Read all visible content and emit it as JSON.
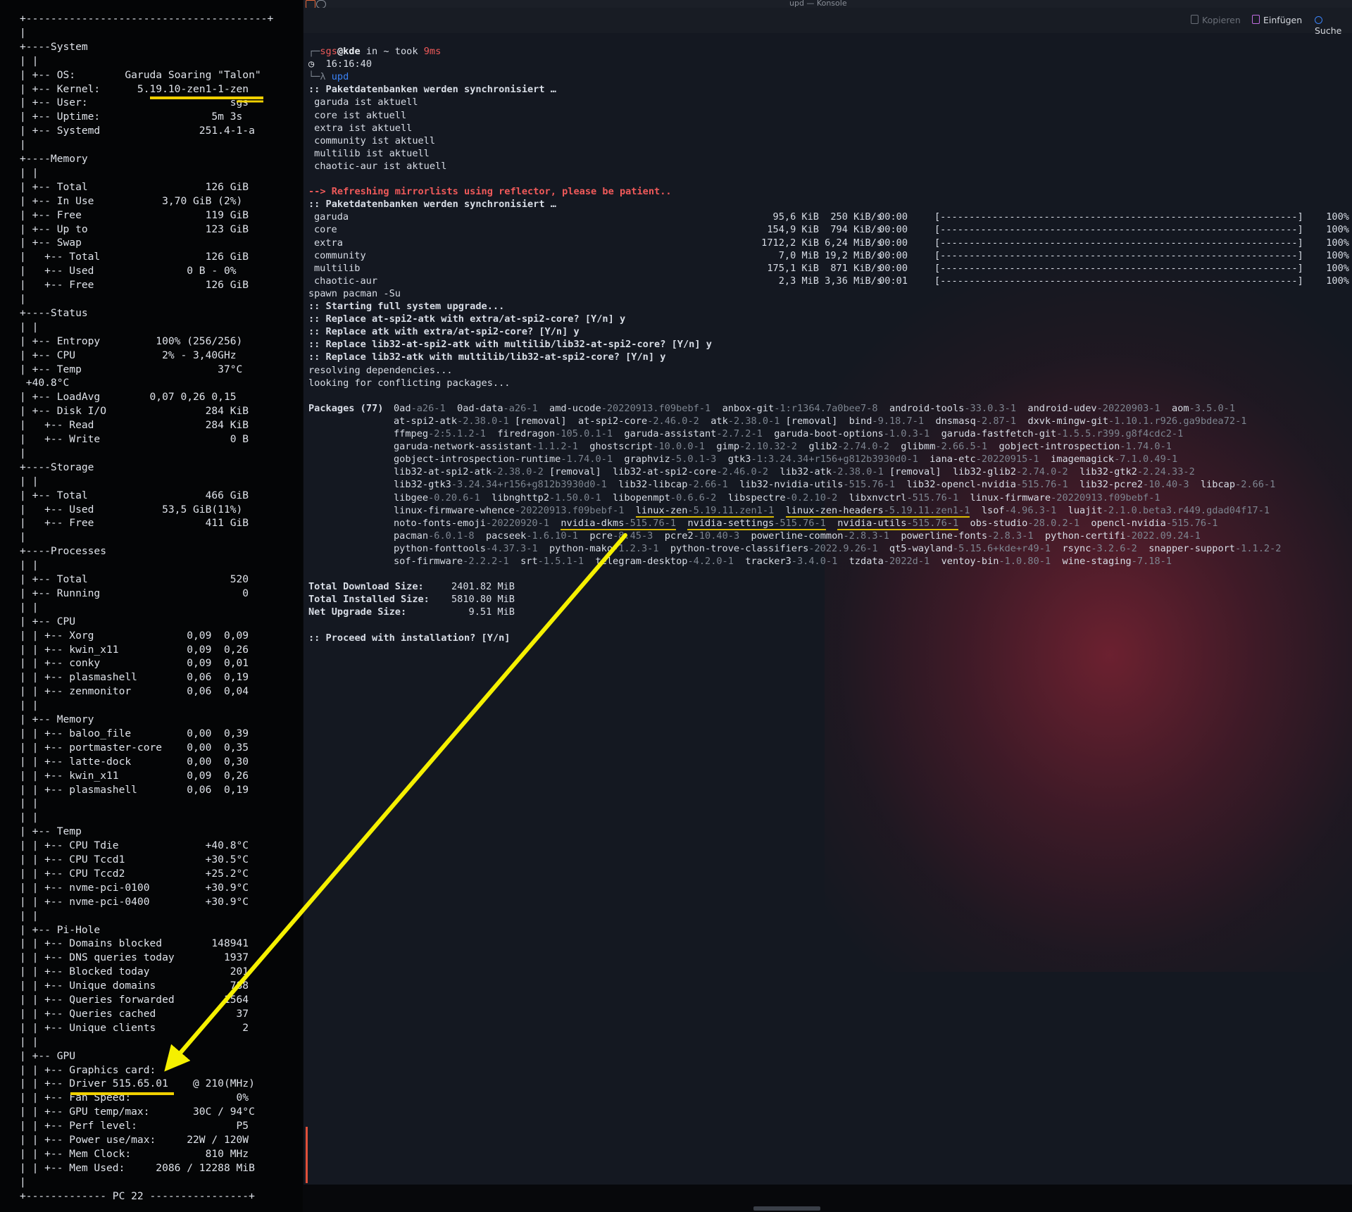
{
  "conky": {
    "lines": [
      "+---------------------------------------+",
      "|",
      "+----System",
      "| |",
      "| +-- OS:        Garuda Soaring \"Talon\"",
      "| +-- Kernel:      5.19.10-zen1-1-zen",
      "| +-- User:                       sgs",
      "| +-- Uptime:                  5m 3s",
      "| +-- Systemd                251.4-1-a",
      "|",
      "+----Memory",
      "| |",
      "| +-- Total                   126 GiB",
      "| +-- In Use           3,70 GiB (2%)",
      "| +-- Free                    119 GiB",
      "| +-- Up to                   123 GiB",
      "| +-- Swap",
      "|   +-- Total                 126 GiB",
      "|   +-- Used               0 B - 0%",
      "|   +-- Free                  126 GiB",
      "|",
      "+----Status",
      "| |",
      "| +-- Entropy         100% (256/256)",
      "| +-- CPU              2% - 3,40GHz",
      "| +-- Temp                      37°C",
      " +40.8°C",
      "| +-- LoadAvg        0,07 0,26 0,15",
      "| +-- Disk I/O                284 KiB",
      "|   +-- Read                  284 KiB",
      "|   +-- Write                     0 B",
      "|",
      "+----Storage",
      "| |",
      "| +-- Total                   466 GiB",
      "|   +-- Used           53,5 GiB(11%)",
      "|   +-- Free                  411 GiB",
      "|",
      "+----Processes",
      "| |",
      "| +-- Total                       520",
      "| +-- Running                       0",
      "| |",
      "| +-- CPU",
      "| | +-- Xorg               0,09  0,09",
      "| | +-- kwin_x11           0,09  0,26",
      "| | +-- conky              0,09  0,01",
      "| | +-- plasmashell        0,06  0,19",
      "| | +-- zenmonitor         0,06  0,04",
      "| |",
      "| +-- Memory",
      "| | +-- baloo_file         0,00  0,39",
      "| | +-- portmaster-core    0,00  0,35",
      "| | +-- latte-dock         0,00  0,30",
      "| | +-- kwin_x11           0,09  0,26",
      "| | +-- plasmashell        0,06  0,19",
      "| |",
      "| |",
      "| +-- Temp",
      "| | +-- CPU Tdie              +40.8°C",
      "| | +-- CPU Tccd1             +30.5°C",
      "| | +-- CPU Tccd2             +25.2°C",
      "| | +-- nvme-pci-0100         +30.9°C",
      "| | +-- nvme-pci-0400         +30.9°C",
      "| |",
      "| +-- Pi-Hole",
      "| | +-- Domains blocked        148941",
      "| | +-- DNS queries today        1937",
      "| | +-- Blocked today             201",
      "| | +-- Unique domains            788",
      "| | +-- Queries forwarded        1564",
      "| | +-- Queries cached             37",
      "| | +-- Unique clients              2",
      "| |",
      "| +-- GPU",
      "| | +-- Graphics card:",
      "| | +-- Driver 515.65.01    @ 210(MHz)",
      "| | +-- Fan Speed:                 0%",
      "| | +-- GPU temp/max:       30C / 94°C",
      "| | +-- Perf level:                P5",
      "| | +-- Power use/max:     22W / 120W",
      "| | +-- Mem Clock:            810 MHz",
      "| | +-- Mem Used:     2086 / 12288 MiB",
      "|",
      "+------------- PC 22 ----------------+"
    ]
  },
  "window": {
    "title": "upd — Konsole",
    "toolbar": {
      "copy": "Kopieren",
      "paste": "Einfügen",
      "search": "Suche"
    }
  },
  "terminal": {
    "prompt": {
      "user": "sgs",
      "host": "kde",
      "in": " in ~ took ",
      "took": "9ms",
      "time": "16:16:40",
      "cmd": "upd"
    },
    "sync_header": ":: Paketdatenbanken werden synchronisiert …",
    "up_to_date": [
      " garuda ist aktuell",
      " core ist aktuell",
      " extra ist aktuell",
      " community ist aktuell",
      " multilib ist aktuell",
      " chaotic-aur ist aktuell"
    ],
    "reflector": "--> Refreshing mirrorlists using reflector, please be patient..",
    "sync_header2": ":: Paketdatenbanken werden synchronisiert …",
    "downloads": [
      {
        "repo": "garuda",
        "size": "95,6 KiB",
        "speed": "250 KiB/s",
        "time": "00:00",
        "pct": "100%"
      },
      {
        "repo": "core",
        "size": "154,9 KiB",
        "speed": "794 KiB/s",
        "time": "00:00",
        "pct": "100%"
      },
      {
        "repo": "extra",
        "size": "1712,2 KiB",
        "speed": "6,24 MiB/s",
        "time": "00:00",
        "pct": "100%"
      },
      {
        "repo": "community",
        "size": "7,0 MiB",
        "speed": "19,2 MiB/s",
        "time": "00:00",
        "pct": "100%"
      },
      {
        "repo": "multilib",
        "size": "175,1 KiB",
        "speed": "871 KiB/s",
        "time": "00:00",
        "pct": "100%"
      },
      {
        "repo": "chaotic-aur",
        "size": "2,3 MiB",
        "speed": "3,36 MiB/s",
        "time": "00:01",
        "pct": "100%"
      }
    ],
    "spawn": "spawn pacman -Su",
    "upgrade": [
      ":: Starting full system upgrade...",
      ":: Replace at-spi2-atk with extra/at-spi2-core? [Y/n] y",
      ":: Replace atk with extra/at-spi2-core? [Y/n] y",
      ":: Replace lib32-at-spi2-atk with multilib/lib32-at-spi2-core? [Y/n] y",
      ":: Replace lib32-atk with multilib/lib32-at-spi2-core? [Y/n] y"
    ],
    "resolving": "resolving dependencies...",
    "conflicts": "looking for conflicting packages...",
    "packages_label": "Packages (77)",
    "package_lines": [
      [
        [
          "0ad",
          "-a26-1"
        ],
        [
          "0ad-data",
          "-a26-1"
        ],
        [
          "amd-ucode",
          "-20220913.f09bebf-1"
        ],
        [
          "anbox-git",
          "-1:r1364.7a0bee7-8"
        ],
        [
          "android-tools",
          "-33.0.3-1"
        ],
        [
          "android-udev",
          "-20220903-1"
        ],
        [
          "aom",
          "-3.5.0-1"
        ]
      ],
      [
        [
          "at-spi2-atk",
          "-2.38.0-1",
          "[removal]"
        ],
        [
          "at-spi2-core",
          "-2.46.0-2"
        ],
        [
          "atk",
          "-2.38.0-1",
          "[removal]"
        ],
        [
          "bind",
          "-9.18.7-1"
        ],
        [
          "dnsmasq",
          "-2.87-1"
        ],
        [
          "dxvk-mingw-git",
          "-1.10.1.r926.ga9bdea72-1"
        ]
      ],
      [
        [
          "ffmpeg",
          "-2:5.1.2-1"
        ],
        [
          "firedragon",
          "-105.0.1-1"
        ],
        [
          "garuda-assistant",
          "-2.7.2-1"
        ],
        [
          "garuda-boot-options",
          "-1.0.3-1"
        ],
        [
          "garuda-fastfetch-git",
          "-1.5.5.r399.g8f4cdc2-1"
        ]
      ],
      [
        [
          "garuda-network-assistant",
          "-1.1.2-1"
        ],
        [
          "ghostscript",
          "-10.0.0-1"
        ],
        [
          "gimp",
          "-2.10.32-2"
        ],
        [
          "glib2",
          "-2.74.0-2"
        ],
        [
          "glibmm",
          "-2.66.5-1"
        ],
        [
          "gobject-introspection",
          "-1.74.0-1"
        ]
      ],
      [
        [
          "gobject-introspection-runtime",
          "-1.74.0-1"
        ],
        [
          "graphviz",
          "-5.0.1-3"
        ],
        [
          "gtk3",
          "-1:3.24.34+r156+g812b3930d0-1"
        ],
        [
          "iana-etc",
          "-20220915-1"
        ],
        [
          "imagemagick",
          "-7.1.0.49-1"
        ]
      ],
      [
        [
          "lib32-at-spi2-atk",
          "-2.38.0-2",
          "[removal]"
        ],
        [
          "lib32-at-spi2-core",
          "-2.46.0-2"
        ],
        [
          "lib32-atk",
          "-2.38.0-1",
          "[removal]"
        ],
        [
          "lib32-glib2",
          "-2.74.0-2"
        ],
        [
          "lib32-gtk2",
          "-2.24.33-2"
        ]
      ],
      [
        [
          "lib32-gtk3",
          "-3.24.34+r156+g812b3930d0-1"
        ],
        [
          "lib32-libcap",
          "-2.66-1"
        ],
        [
          "lib32-nvidia-utils",
          "-515.76-1"
        ],
        [
          "lib32-opencl-nvidia",
          "-515.76-1"
        ],
        [
          "lib32-pcre2",
          "-10.40-3"
        ],
        [
          "libcap",
          "-2.66-1"
        ]
      ],
      [
        [
          "libgee",
          "-0.20.6-1"
        ],
        [
          "libnghttp2",
          "-1.50.0-1"
        ],
        [
          "libopenmpt",
          "-0.6.6-2"
        ],
        [
          "libspectre",
          "-0.2.10-2"
        ],
        [
          "libxnvctrl",
          "-515.76-1"
        ],
        [
          "linux-firmware",
          "-20220913.f09bebf-1"
        ]
      ],
      [
        [
          "linux-firmware-whence",
          "-20220913.f09bebf-1"
        ],
        [
          "linux-zen",
          "-5.19.11.zen1-1",
          "",
          "u"
        ],
        [
          "linux-zen-headers",
          "-5.19.11.zen1-1",
          "",
          "u"
        ],
        [
          "lsof",
          "-4.96.3-1"
        ],
        [
          "luajit",
          "-2.1.0.beta3.r449.gdad04f17-1"
        ]
      ],
      [
        [
          "noto-fonts-emoji",
          "-20220920-1"
        ],
        [
          "nvidia-dkms",
          "-515.76-1",
          "",
          "u"
        ],
        [
          "nvidia-settings",
          "-515.76-1",
          "",
          "u"
        ],
        [
          "nvidia-utils",
          "-515.76-1",
          "",
          "u"
        ],
        [
          "obs-studio",
          "-28.0.2-1"
        ],
        [
          "opencl-nvidia",
          "-515.76-1"
        ]
      ],
      [
        [
          "pacman",
          "-6.0.1-8"
        ],
        [
          "pacseek",
          "-1.6.10-1"
        ],
        [
          "pcre",
          "-8.45-3"
        ],
        [
          "pcre2",
          "-10.40-3"
        ],
        [
          "powerline-common",
          "-2.8.3-1"
        ],
        [
          "powerline-fonts",
          "-2.8.3-1"
        ],
        [
          "python-certifi",
          "-2022.09.24-1"
        ]
      ],
      [
        [
          "python-fonttools",
          "-4.37.3-1"
        ],
        [
          "python-mako",
          "-1.2.3-1"
        ],
        [
          "python-trove-classifiers",
          "-2022.9.26-1"
        ],
        [
          "qt5-wayland",
          "-5.15.6+kde+r49-1"
        ],
        [
          "rsync",
          "-3.2.6-2"
        ],
        [
          "snapper-support",
          "-1.1.2-2"
        ]
      ],
      [
        [
          "sof-firmware",
          "-2.2.2-1"
        ],
        [
          "srt",
          "-1.5.1-1"
        ],
        [
          "telegram-desktop",
          "-4.2.0-1"
        ],
        [
          "tracker3",
          "-3.4.0-1"
        ],
        [
          "tzdata",
          "-2022d-1"
        ],
        [
          "ventoy-bin",
          "-1.0.80-1"
        ],
        [
          "wine-staging",
          "-7.18-1"
        ]
      ]
    ],
    "totals": [
      {
        "label": "Total Download Size:",
        "value": "2401.82 MiB"
      },
      {
        "label": "Total Installed Size:",
        "value": "5810.80 MiB"
      },
      {
        "label": "Net Upgrade Size:",
        "value": "9.51 MiB"
      }
    ],
    "proceed": ":: Proceed with installation? [Y/n]"
  },
  "colors": {
    "accent": "#f05a5a",
    "arrow": "#f5f000",
    "underline": "#f0d000"
  }
}
